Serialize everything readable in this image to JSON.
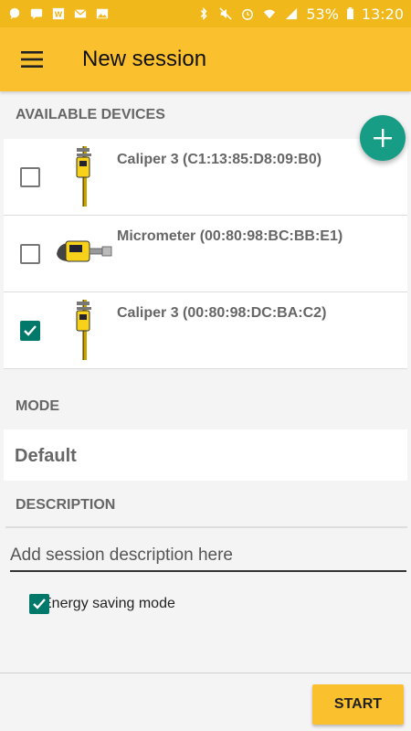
{
  "status_bar": {
    "battery_percent": "53%",
    "time": "13:20",
    "left_icons": [
      "chat-bubble-icon",
      "message-icon",
      "wolt-app-icon",
      "mail-icon",
      "image-icon"
    ],
    "right_icons": [
      "bluetooth-icon",
      "mute-icon",
      "alarm-icon",
      "wifi-icon",
      "signal-icon",
      "battery-icon"
    ]
  },
  "app_bar": {
    "menu_icon": "hamburger-menu-icon",
    "title": "New session",
    "color": "#fbc02d"
  },
  "available_devices": {
    "header": "AVAILABLE DEVICES",
    "add_icon": "plus-icon",
    "fab_color": "#179c85",
    "items": [
      {
        "name": "Caliper 3 (C1:13:85:D8:09:B0)",
        "checked": false,
        "icon": "caliper-icon"
      },
      {
        "name": "Micrometer (00:80:98:BC:BB:E1)",
        "checked": false,
        "icon": "micrometer-icon"
      },
      {
        "name": "Caliper 3 (00:80:98:DC:BA:C2)",
        "checked": true,
        "icon": "caliper-icon"
      }
    ]
  },
  "mode": {
    "header": "MODE",
    "value": "Default"
  },
  "description": {
    "header": "DESCRIPTION",
    "value": "",
    "placeholder": "Add session description here"
  },
  "energy_saving": {
    "label": "Energy saving mode",
    "checked": true
  },
  "footer": {
    "start_label": "START"
  },
  "colors": {
    "checkbox_checked": "#00796b"
  }
}
